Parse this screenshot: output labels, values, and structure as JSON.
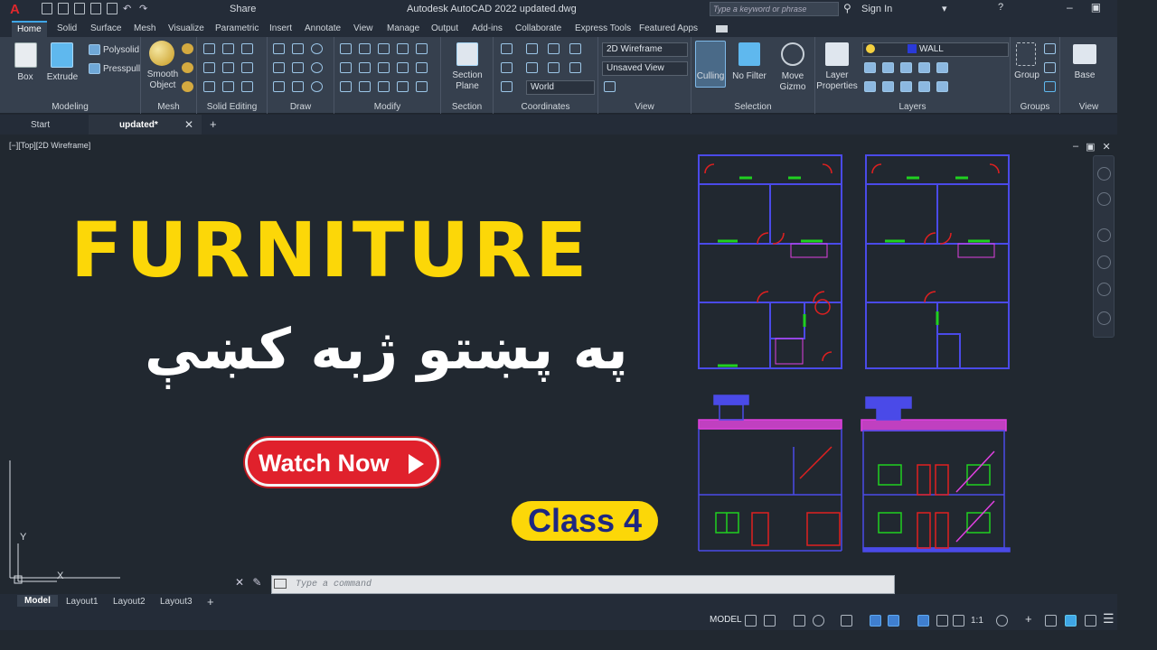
{
  "titlebar": {
    "app_logo": "A",
    "share_label": "Share",
    "title": "Autodesk AutoCAD 2022   updated.dwg",
    "search_placeholder": "Type a keyword or phrase",
    "sign_in": "Sign In"
  },
  "ribbon_tabs": [
    "Home",
    "Solid",
    "Surface",
    "Mesh",
    "Visualize",
    "Parametric",
    "Insert",
    "Annotate",
    "View",
    "Manage",
    "Output",
    "Add-ins",
    "Collaborate",
    "Express Tools",
    "Featured Apps"
  ],
  "ribbon": {
    "box": "Box",
    "extrude": "Extrude",
    "polysolid": "Polysolid",
    "presspull": "Presspull",
    "smooth_object": "Smooth Object",
    "section_plane": "Section Plane",
    "visual_style": "2D Wireframe",
    "view_name": "Unsaved View",
    "ucs": "World",
    "culling": "Culling",
    "no_filter": "No Filter",
    "move_gizmo": "Move Gizmo",
    "layer_properties": "Layer Properties",
    "layer_name": "WALL",
    "group": "Group",
    "base": "Base",
    "panels": [
      "Modeling",
      "Mesh",
      "Solid Editing",
      "Draw",
      "Modify",
      "Section",
      "Coordinates",
      "View",
      "Selection",
      "Layers",
      "Groups",
      "View"
    ]
  },
  "doc_tabs": {
    "start": "Start",
    "current": "updated*"
  },
  "viewport": {
    "label": "[−][Top][2D Wireframe]",
    "headline": "FURNITURE",
    "pashto_text": "په پښتو ژبه کښې",
    "watch_button": "Watch Now",
    "class_badge": "Class 4",
    "ucs_y": "Y",
    "ucs_x": "X"
  },
  "command": {
    "placeholder": "Type a command"
  },
  "layout_tabs": [
    "Model",
    "Layout1",
    "Layout2",
    "Layout3"
  ],
  "status": {
    "model": "MODEL",
    "scale": "1:1"
  },
  "colors": {
    "accent": "#fcd708",
    "button_red": "#e0212c",
    "wall_blue": "#3a3ae0",
    "door_red": "#e02020",
    "window_green": "#20d020",
    "hatch_magenta": "#e040e0"
  }
}
